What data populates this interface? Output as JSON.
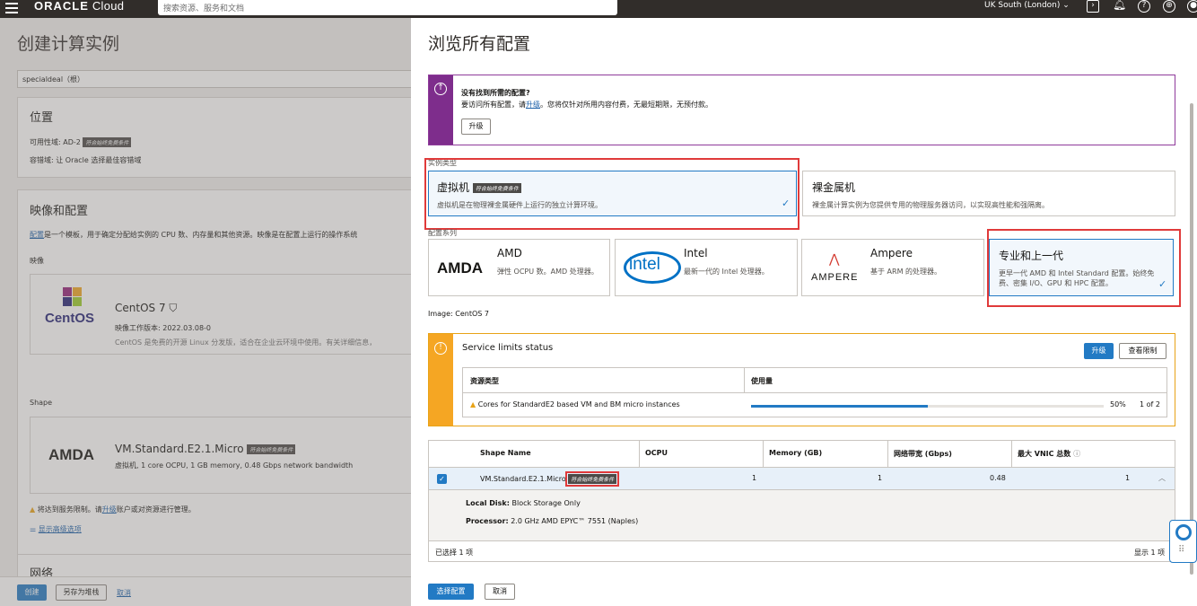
{
  "topbar": {
    "logo_brand": "ORACLE",
    "logo_product": "Cloud",
    "search_placeholder": "搜索资源、服务和文档",
    "region": "UK South (London)"
  },
  "left": {
    "title": "创建计算实例",
    "compartment_value": "specialdeal（根）",
    "placement": {
      "title": "位置",
      "ad_label": "可用性域:",
      "ad_value": "AD-2",
      "badge": "符合始终免费条件",
      "fault_label": "容错域:",
      "fault_value": "让 Oracle 选择最佳容错域"
    },
    "image_shape": {
      "title": "映像和配置",
      "intro_link": "配置",
      "intro_text": "是一个模板，用于确定分配给实例的 CPU 数、内存量和其他资源。映像是在配置上运行的操作系统",
      "image_label": "映像",
      "image_logo": "CentOS",
      "image_name": "CentOS 7",
      "image_build": "映像工作版本: 2022.03.08-0",
      "image_desc": "CentOS 是免费的开源 Linux 分发版，适合在企业云环境中使用。有关详细信息，",
      "shape_label": "Shape",
      "shape_logo": "AMDA",
      "shape_name": "VM.Standard.E2.1.Micro",
      "shape_badge": "符合始终免费条件",
      "shape_desc": "虚拟机, 1 core OCPU, 1 GB memory, 0.48 Gbps network bandwidth",
      "warning_pre": "将达到服务限制。请",
      "warning_link": "升级",
      "warning_post": "账户或对资源进行管理。",
      "advanced_link": "显示高级选项"
    },
    "network_title": "网络",
    "footer": {
      "create": "创建",
      "save_stack": "另存为堆栈",
      "cancel": "取消"
    }
  },
  "panel": {
    "title": "浏览所有配置",
    "notice": {
      "heading": "没有找到所需的配置?",
      "text_pre": "要访问所有配置，请",
      "text_link": "升级",
      "text_post": "。您将仅针对所用内容付费，无最短期限，无预付款。",
      "button": "升级"
    },
    "instance_type_label": "实例类型",
    "instance_types": [
      {
        "title": "虚拟机",
        "badge": "符合始终免费条件",
        "desc": "虚拟机是在物理裸金属硬件上运行的独立计算环境。"
      },
      {
        "title": "裸金属机",
        "desc": "裸金属计算实例为您提供专用的物理服务器访问，以实现高性能和强隔离。"
      }
    ],
    "series_label": "配置系列",
    "series": [
      {
        "logo": "AMDA",
        "title": "AMD",
        "desc": "弹性 OCPU 数。AMD 处理器。"
      },
      {
        "logo": "intel",
        "title": "Intel",
        "desc": "最新一代的 Intel 处理器。"
      },
      {
        "logo": "AMPERE",
        "title": "Ampere",
        "desc": "基于 ARM 的处理器。"
      },
      {
        "title": "专业和上一代",
        "desc": "更早一代 AMD 和 Intel Standard 配置。始终免费、密集 I/O、GPU 和 HPC 配置。"
      }
    ],
    "image_line": "Image: CentOS 7",
    "service_limits": {
      "title": "Service limits status",
      "upgrade": "升级",
      "view_limits": "查看限制",
      "col_resource": "资源类型",
      "col_usage": "使用量",
      "resource": "Cores for StandardE2 based VM and BM micro instances",
      "usage_percent": "50%",
      "usage_fraction": 0.5,
      "usage_count": "1 of 2"
    },
    "shape_table": {
      "headers": [
        "Shape Name",
        "OCPU",
        "Memory (GB)",
        "网络带宽 (Gbps)",
        "最大 VNIC 总数"
      ],
      "row": {
        "name": "VM.Standard.E2.1.Micro",
        "badge": "符合始终免费条件",
        "ocpu": "1",
        "memory": "1",
        "bandwidth": "0.48",
        "vnic": "1"
      },
      "local_disk_label": "Local Disk:",
      "local_disk_value": "Block Storage Only",
      "processor_label": "Processor:",
      "processor_value": "2.0 GHz AMD EPYC™ 7551 (Naples)",
      "selected_count": "已选择 1 项",
      "showing": "显示 1 项"
    },
    "footer": {
      "select": "选择配置",
      "cancel": "取消"
    }
  }
}
